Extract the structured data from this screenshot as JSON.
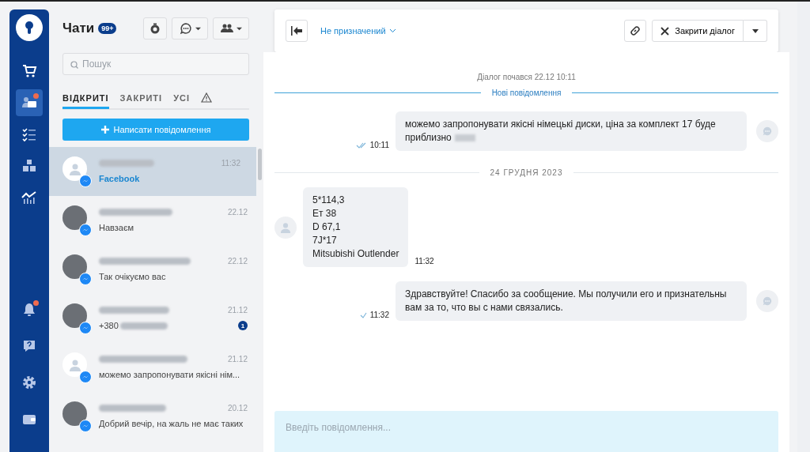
{
  "nav": {
    "top": [
      {
        "kind": "cart",
        "selected": false,
        "alert": false
      },
      {
        "kind": "chats",
        "selected": true,
        "alert": true
      },
      {
        "kind": "tasks",
        "selected": false,
        "alert": false
      },
      {
        "kind": "boxes",
        "selected": false,
        "alert": false
      },
      {
        "kind": "analytics",
        "selected": false,
        "alert": false
      }
    ],
    "bottom": [
      {
        "kind": "bell",
        "selected": false,
        "alert": true
      },
      {
        "kind": "help",
        "selected": false,
        "alert": false
      },
      {
        "kind": "settings",
        "selected": false,
        "alert": false
      },
      {
        "kind": "wallet",
        "selected": false,
        "alert": false
      }
    ]
  },
  "chat_list": {
    "title": "Чати",
    "count": "99+",
    "search": {
      "placeholder": "Пошук"
    },
    "tabs": [
      {
        "kind": "text",
        "label": "ВІДКРИТІ",
        "selected": true
      },
      {
        "kind": "text",
        "label": "ЗАКРИТІ",
        "selected": false
      },
      {
        "kind": "text",
        "label": "УСІ",
        "selected": false
      },
      {
        "kind": "warning",
        "selected": false
      }
    ],
    "new_message_button": "Написати повідомлення",
    "chats": [
      {
        "photo": false,
        "time": "11:32",
        "preview": "Facebook",
        "kind": "channel",
        "selected": true
      },
      {
        "photo": true,
        "time": "22.12",
        "preview": "Навзаєм",
        "kind": "message",
        "selected": false
      },
      {
        "photo": true,
        "time": "22.12",
        "preview": "Так очікуємо вас",
        "kind": "message",
        "selected": false
      },
      {
        "photo": true,
        "time": "21.12",
        "preview": "+380",
        "kind": "message",
        "selected": false,
        "unread": "1"
      },
      {
        "photo": false,
        "time": "21.12",
        "preview": "можемо запропонувати якісні нім...",
        "kind": "message",
        "selected": false
      },
      {
        "photo": true,
        "time": "20.12",
        "preview": "Добрий вечір, на жаль не має таких",
        "kind": "message",
        "selected": false
      }
    ]
  },
  "dialog": {
    "assignee": "Не призначений",
    "close_button": "Закрити діалог",
    "started": "Діалог почався 22.12 10:11",
    "new_divider": "Нові повідомлення",
    "messages": [
      {
        "kind": "outgoing",
        "text": "можемо запропонувати якісні німецькі диски, ціна за комплект 17 буде приблизно",
        "redacted": true,
        "time": "10:11",
        "read": true
      },
      {
        "kind": "date",
        "text": "24 ГРУДНЯ 2023"
      },
      {
        "kind": "incoming",
        "text": "5*114,3\nЕт 38\nD 67,1\n7J*17\nMitsubishi Outlender",
        "time": "11:32"
      },
      {
        "kind": "outgoing",
        "text": "Здравствуйте! Спасибо за сообщение. Мы получили его и признательны вам за то, что вы с нами связались.",
        "redacted": false,
        "time": "11:32",
        "read": false
      }
    ],
    "composer": {
      "placeholder": "Введіть повідомлення..."
    }
  }
}
